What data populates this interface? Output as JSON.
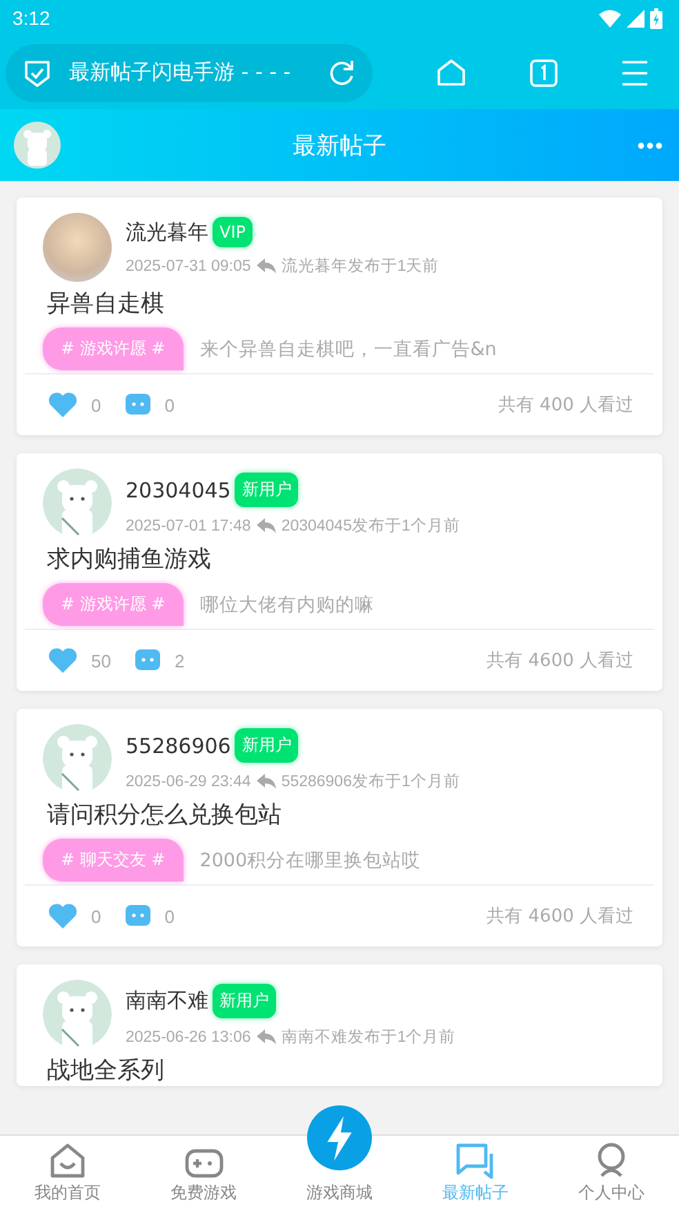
{
  "status_bar": {
    "time": "3:12"
  },
  "browser": {
    "address": "最新帖子闪电手游 - - - -"
  },
  "header": {
    "title": "最新帖子"
  },
  "posts": [
    {
      "avatar": {
        "kind": "photo"
      },
      "name": "流光暮年",
      "badge": "VIP",
      "date": "2025-07-31 09:05",
      "note": "流光暮年发布于1天前",
      "title": "异兽自走棋",
      "tag": "# 游戏许愿 #",
      "excerpt": "来个异兽自走棋吧，一直看广告&n",
      "likes": "0",
      "comments": "0",
      "views": "共有 400 人看过"
    },
    {
      "avatar": {
        "kind": "bear"
      },
      "name": "20304045",
      "badge": "新用户",
      "date": "2025-07-01 17:48",
      "note": "20304045发布于1个月前",
      "title": "求内购捕鱼游戏",
      "tag": "# 游戏许愿 #",
      "excerpt": "哪位大佬有内购的嘛",
      "likes": "50",
      "comments": "2",
      "views": "共有 4600 人看过"
    },
    {
      "avatar": {
        "kind": "bear"
      },
      "name": "55286906",
      "badge": "新用户",
      "date": "2025-06-29 23:44",
      "note": "55286906发布于1个月前",
      "title": "请问积分怎么兑换包站",
      "tag": "# 聊天交友 #",
      "excerpt": "2000积分在哪里换包站哎",
      "likes": "0",
      "comments": "0",
      "views": "共有 4600 人看过"
    },
    {
      "avatar": {
        "kind": "bear"
      },
      "name": "南南不难",
      "badge": "新用户",
      "date": "2025-06-26 13:06",
      "note": "南南不难发布于1个月前",
      "title": "战地全系列"
    }
  ],
  "nav": [
    {
      "kind": "home",
      "label": "我的首页",
      "selected": false
    },
    {
      "kind": "gamepad",
      "label": "免费游戏",
      "selected": false
    },
    {
      "kind": "center",
      "label": "游戏商城",
      "selected": false
    },
    {
      "kind": "chat",
      "label": "最新帖子",
      "selected": true
    },
    {
      "kind": "person",
      "label": "个人中心",
      "selected": false
    }
  ]
}
